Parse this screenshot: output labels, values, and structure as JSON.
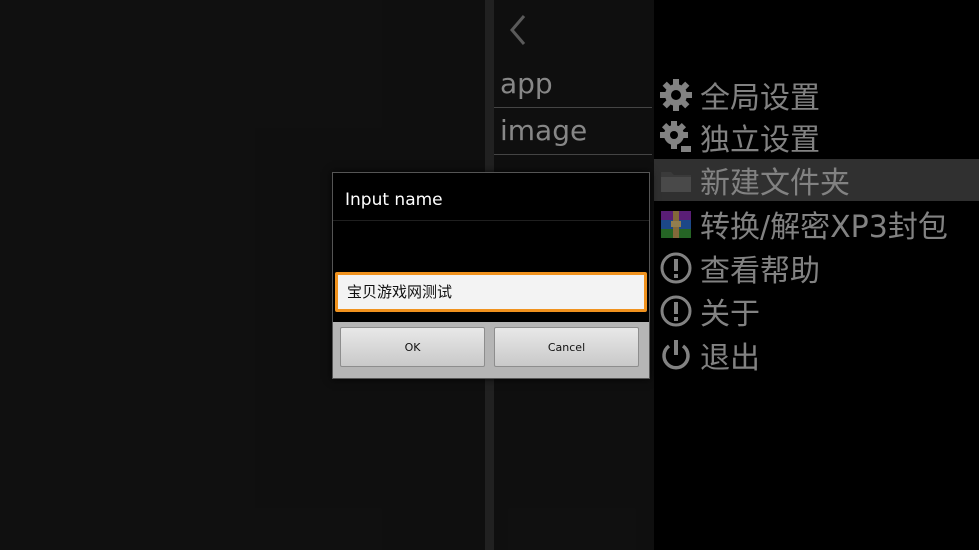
{
  "file_browser": {
    "back_icon": "chevron-left-icon",
    "items": [
      "app",
      "image"
    ]
  },
  "menu": {
    "items": [
      {
        "label": "全局设置",
        "icon": "gear-icon"
      },
      {
        "label": "独立设置",
        "icon": "gear-person-icon"
      },
      {
        "label": "新建文件夹",
        "icon": "folder-icon"
      },
      {
        "label": "转换/解密XP3封包",
        "icon": "archive-icon"
      },
      {
        "label": "查看帮助",
        "icon": "info-icon"
      },
      {
        "label": "关于",
        "icon": "info-icon"
      },
      {
        "label": "退出",
        "icon": "power-icon"
      }
    ],
    "highlight_color": "#4a4a4a"
  },
  "dialog": {
    "title": "Input name",
    "input_value": "宝贝游戏网测试",
    "ok_label": "OK",
    "cancel_label": "Cancel",
    "focus_color": "#f0921e"
  }
}
